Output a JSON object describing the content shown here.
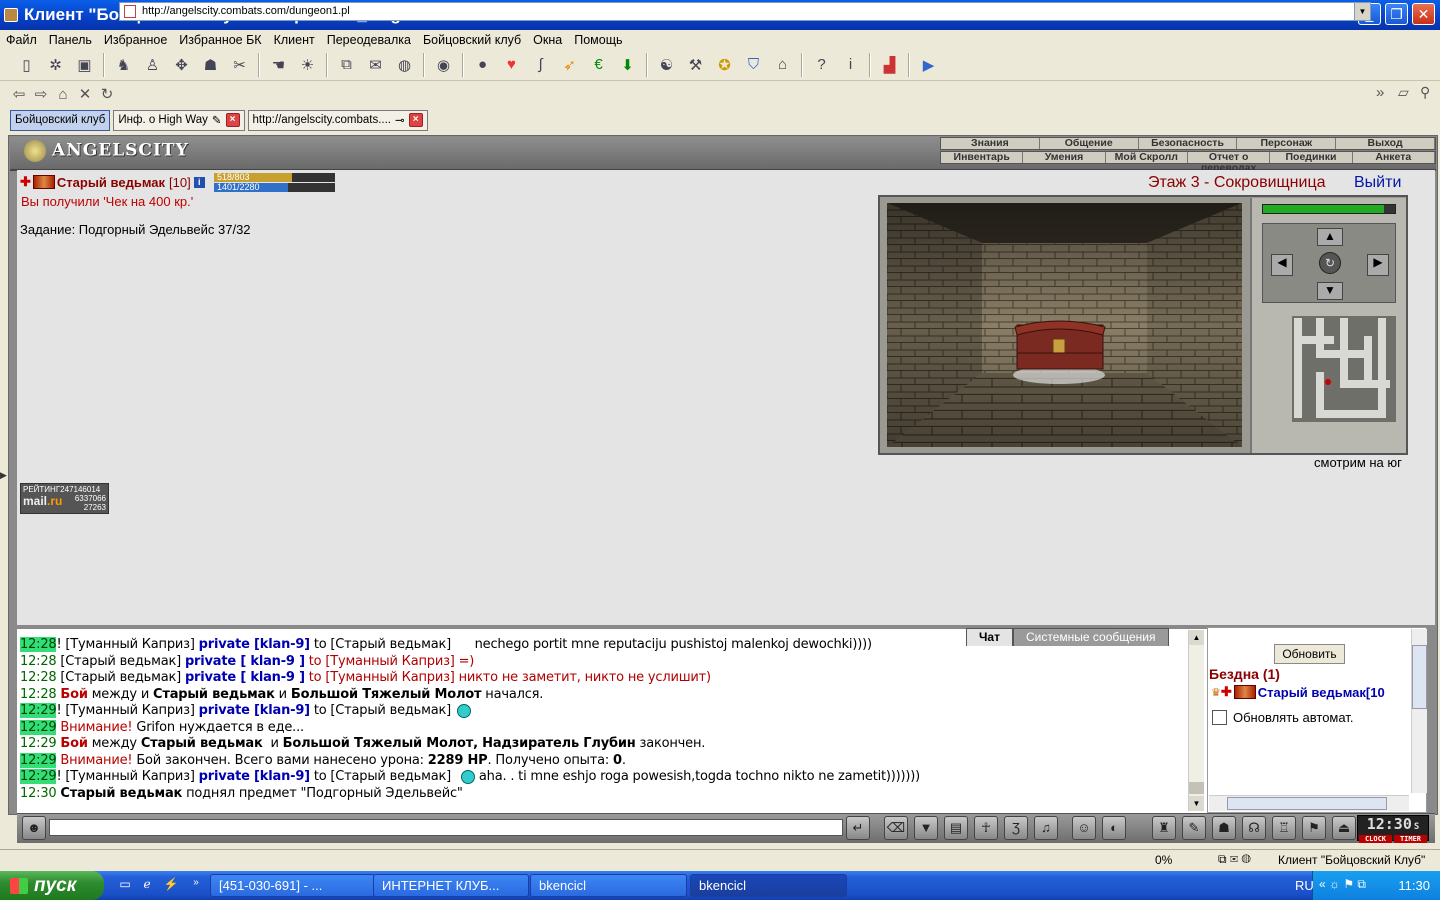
{
  "window": {
    "title": "Клиент \"Бойцовский клуб\" автор Blood_Magic"
  },
  "menu": [
    "Файл",
    "Панель",
    "Избранное",
    "Избранное БК",
    "Клиент",
    "Переодевалка",
    "Бойцовский клуб",
    "Окна",
    "Помощь"
  ],
  "address": {
    "url": "http://angelscity.combats.com/dungeon1.pl"
  },
  "tabs": [
    {
      "label": "Бойцовский клуб"
    },
    {
      "label": "Инф. о High Way"
    },
    {
      "label": "http://angelscity.combats...."
    }
  ],
  "game": {
    "logo": "ANGELSCITY",
    "topmenu_row1": [
      "Знания",
      "Общение",
      "Безопасность",
      "Персонаж",
      "Выход"
    ],
    "topmenu_row2": [
      "Инвентарь",
      "Умения",
      "Мой Скролл",
      "Отчет о переводах",
      "Поединки",
      "Анкета"
    ],
    "player": {
      "name": "Старый ведьмак",
      "level": "[10]",
      "hp": "518/803",
      "hp_fraction": 0.645,
      "mana": "1401/2280",
      "mana_fraction": 0.615
    },
    "message": "Вы получили 'Чек на 400 кр.'",
    "quest": "Задание: Подгорный Эдельвейс 37/32",
    "floor": "Этаж 3 - Сокровищница",
    "exit": "Выйти",
    "facing": "смотрим на юг",
    "counter": {
      "label": "РЕЙТИНГ",
      "n1": "247146014",
      "n2": "6337066",
      "n3": "27263",
      "brand": "mail",
      "brand2": ".ru"
    }
  },
  "chat": {
    "tabs": [
      "Чат",
      "Системные сообщения"
    ],
    "lines": [
      {
        "time": "12:28",
        "hl": true,
        "pre": "! ",
        "parts": [
          {
            "t": "[Туманный Каприз] ",
            "c": "nk"
          },
          {
            "t": "private [klan-9]",
            "c": "pv"
          },
          {
            "t": " to [Старый ведьмак]",
            "c": "nk"
          },
          {
            "t": "      nechego portit mne reputaciju pushistoj malenkoj dewochki))))",
            "c": "txt"
          }
        ]
      },
      {
        "time": "12:28",
        "hl": false,
        "pre": " ",
        "parts": [
          {
            "t": "[Старый ведьмак] ",
            "c": "nk"
          },
          {
            "t": "private [ klan-9 ]",
            "c": "pv"
          },
          {
            "t": " to [Туманный Каприз] =)",
            "c": "redt"
          }
        ]
      },
      {
        "time": "12:28",
        "hl": false,
        "pre": " ",
        "parts": [
          {
            "t": "[Старый ведьмак] ",
            "c": "nk"
          },
          {
            "t": "private [ klan-9 ]",
            "c": "pv"
          },
          {
            "t": " to [Туманный Каприз] никто не заметит, никто не услишит)",
            "c": "redt"
          }
        ]
      },
      {
        "time": "12:28",
        "hl": false,
        "pre": " ",
        "parts": [
          {
            "t": "Бой",
            "c": "red bold"
          },
          {
            "t": " между и ",
            "c": "txt"
          },
          {
            "t": "Старый ведьмак",
            "c": "bold"
          },
          {
            "t": " и ",
            "c": "txt"
          },
          {
            "t": "Большой Тяжелый Молот",
            "c": "bold"
          },
          {
            "t": " начался.",
            "c": "txt"
          }
        ]
      },
      {
        "time": "12:29",
        "hl": true,
        "pre": "! ",
        "parts": [
          {
            "t": "[Туманный Каприз] ",
            "c": "nk"
          },
          {
            "t": "private [klan-9]",
            "c": "pv"
          },
          {
            "t": " to [Старый ведьмак]",
            "c": "nk"
          }
        ],
        "smile": true
      },
      {
        "time": "12:29",
        "hl": true,
        "pre": " ",
        "parts": [
          {
            "t": "Внимание!",
            "c": "red"
          },
          {
            "t": " Grifon нуждается в еде...",
            "c": "txt"
          }
        ]
      },
      {
        "time": "12:29",
        "hl": false,
        "pre": " ",
        "parts": [
          {
            "t": "Бой",
            "c": "red bold"
          },
          {
            "t": " между ",
            "c": "txt"
          },
          {
            "t": "Старый ведьмак",
            "c": "bold"
          },
          {
            "t": "  и ",
            "c": "txt"
          },
          {
            "t": "Большой Тяжелый Молот, Надзиратель Глубин",
            "c": "bold"
          },
          {
            "t": " закончен.",
            "c": "txt"
          }
        ]
      },
      {
        "time": "12:29",
        "hl": true,
        "pre": " ",
        "parts": [
          {
            "t": "Внимание!",
            "c": "red"
          },
          {
            "t": " Бой закончен. Всего вами нанесено урона: ",
            "c": "txt"
          },
          {
            "t": "2289 HP",
            "c": "bold"
          },
          {
            "t": ". Получено опыта: ",
            "c": "txt"
          },
          {
            "t": "0",
            "c": "bold"
          },
          {
            "t": ".",
            "c": "txt"
          }
        ]
      },
      {
        "time": "12:29",
        "hl": true,
        "pre": "! ",
        "parts": [
          {
            "t": "[Туманный Каприз] ",
            "c": "nk"
          },
          {
            "t": "private [klan-9]",
            "c": "pv"
          },
          {
            "t": " to [Старый ведьмак] ",
            "c": "nk"
          }
        ],
        "smile": true,
        "after": " aha. . ti mne eshjo roga powesish,togda tochno nikto ne zametit)))))))"
      },
      {
        "time": "12:30",
        "hl": false,
        "pre": " ",
        "parts": [
          {
            "t": "Старый ведьмак",
            "c": "bold"
          },
          {
            "t": " поднял предмет \"Подгорный Эдельвейс\"",
            "c": "txt"
          }
        ]
      }
    ]
  },
  "side": {
    "refresh": "Обновить",
    "room": "Бездна (1)",
    "user": "Старый ведьмак[10",
    "autorefresh": "Обновлять автомат."
  },
  "clock": {
    "time": "12:30",
    "sec": "S",
    "clock_label": "CLOCK",
    "timer_label": "TIMER"
  },
  "status": {
    "percent": "0%",
    "client": "Клиент \"Бойцовский Клуб\""
  },
  "taskbar": {
    "start": "пуск",
    "items": [
      "[451-030-691] - ...",
      "ИНТЕРНЕТ КЛУБ...",
      "bkencicl",
      "bkencicl"
    ],
    "lang": "RU",
    "time": "11:30"
  }
}
